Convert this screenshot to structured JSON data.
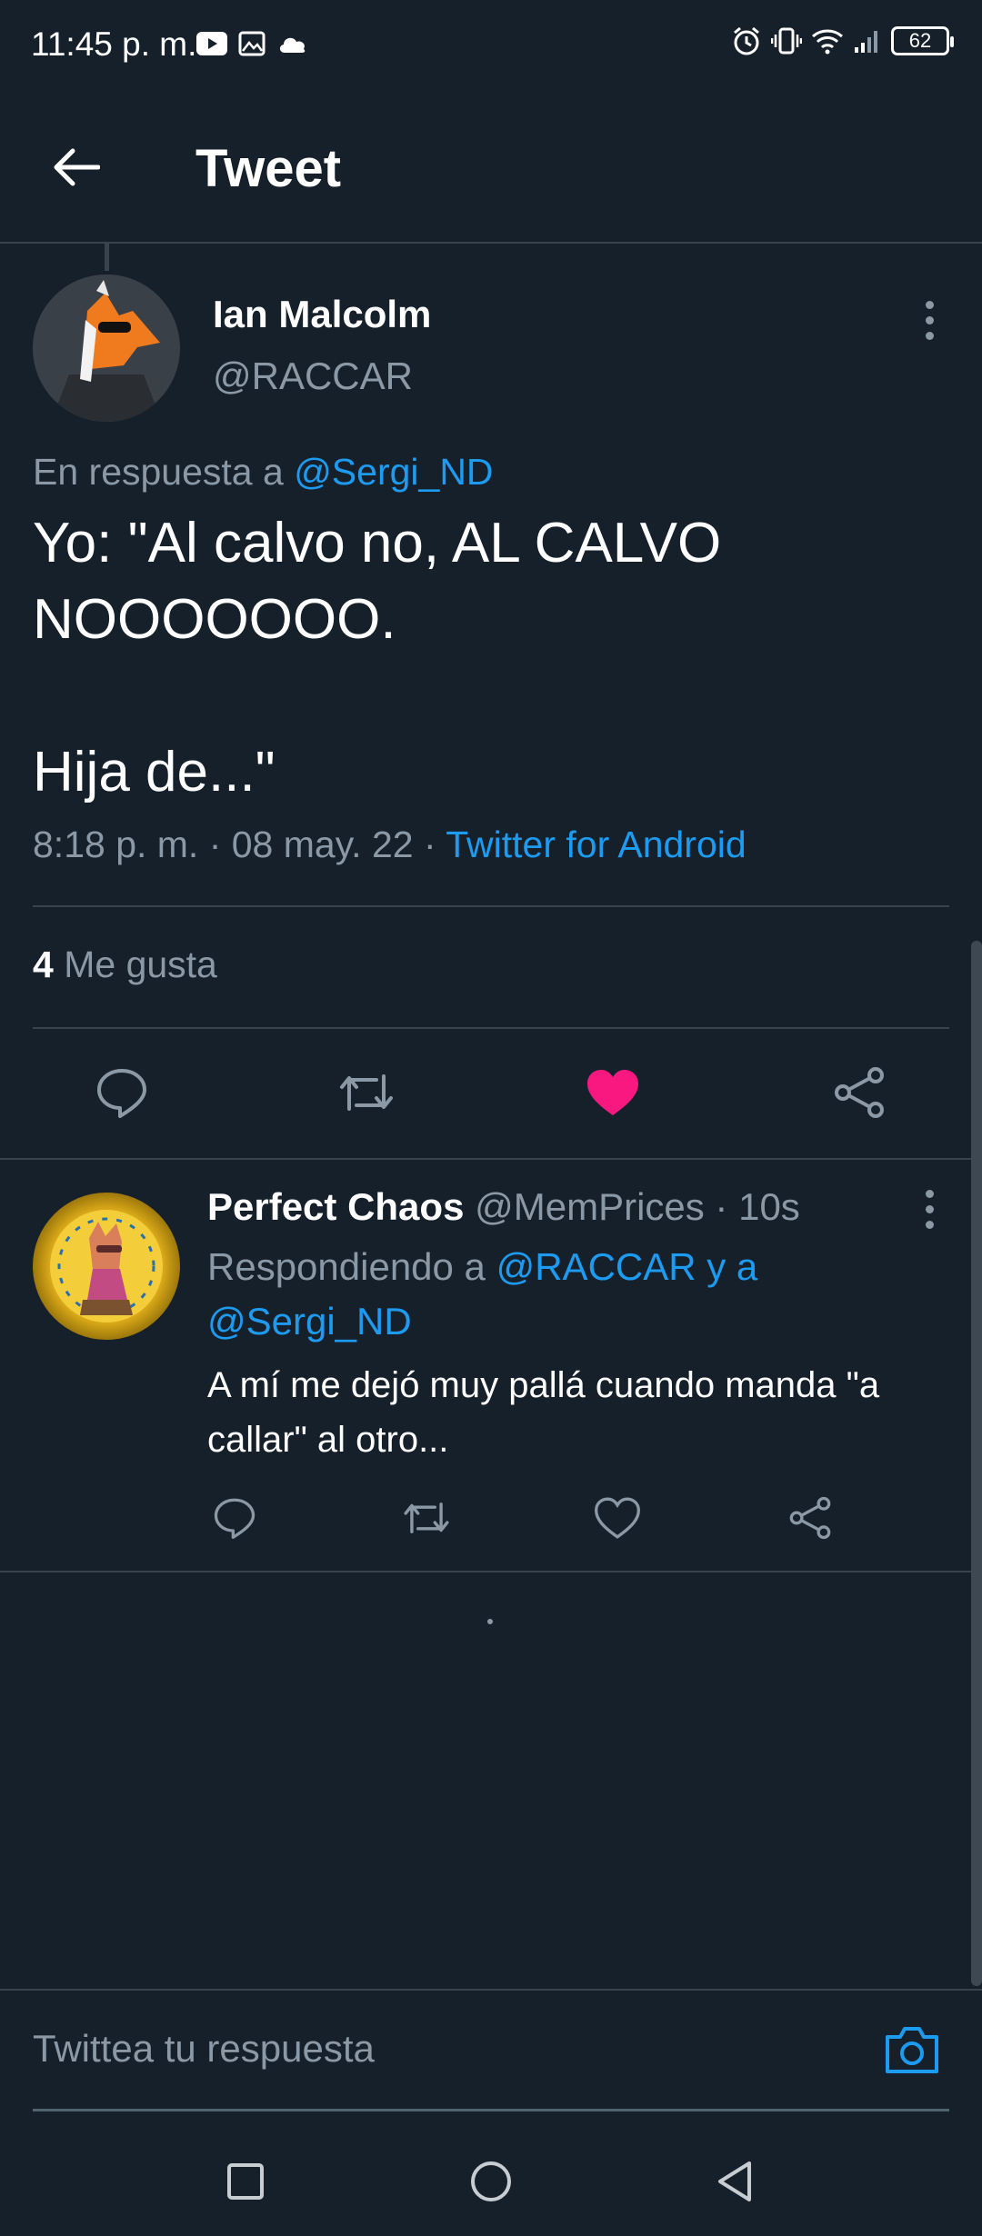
{
  "status_bar": {
    "time": "11:45 p. m.",
    "battery": "62"
  },
  "header": {
    "title": "Tweet"
  },
  "tweet": {
    "author_name": "Ian Malcolm",
    "author_handle": "@RACCAR",
    "reply_prefix": "En respuesta a ",
    "reply_to": "@Sergi_ND",
    "text": "Yo: \"Al calvo no, AL CALVO NOOOOOOO.\n\nHija de...\"",
    "time_date": "8:18 p. m. · 08 may. 22 · ",
    "source": "Twitter for Android",
    "likes_count": "4",
    "likes_label": "Me gusta",
    "liked": true,
    "like_color": "#f91880"
  },
  "reply": {
    "author_name": "Perfect Chaos",
    "author_meta": " @MemPrices · 10s",
    "replying_prefix": "Respondiendo a ",
    "replying_users": "@RACCAR y a @Sergi_ND",
    "text": "A mí me dejó muy pallá cuando manda \"a callar\" al otro..."
  },
  "compose": {
    "placeholder": "Twittea tu respuesta"
  },
  "colors": {
    "background": "#15202b",
    "accent": "#1d9bf0",
    "muted": "#8b98a5",
    "divider": "#38444d"
  }
}
